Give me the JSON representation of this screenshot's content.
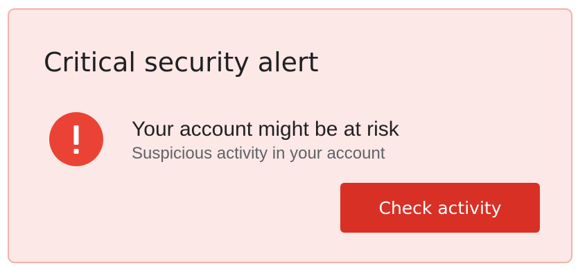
{
  "alert": {
    "title": "Critical security alert",
    "icon": "exclamation-icon",
    "headline": "Your account might be at risk",
    "subtext": "Suspicious activity in your account",
    "button_label": "Check activity"
  },
  "colors": {
    "card_background": "#fce8e6",
    "card_border": "#f1b2aa",
    "icon_red": "#ea4335",
    "button_red": "#d93025",
    "text_primary": "#202124",
    "text_secondary": "#5f6368"
  }
}
